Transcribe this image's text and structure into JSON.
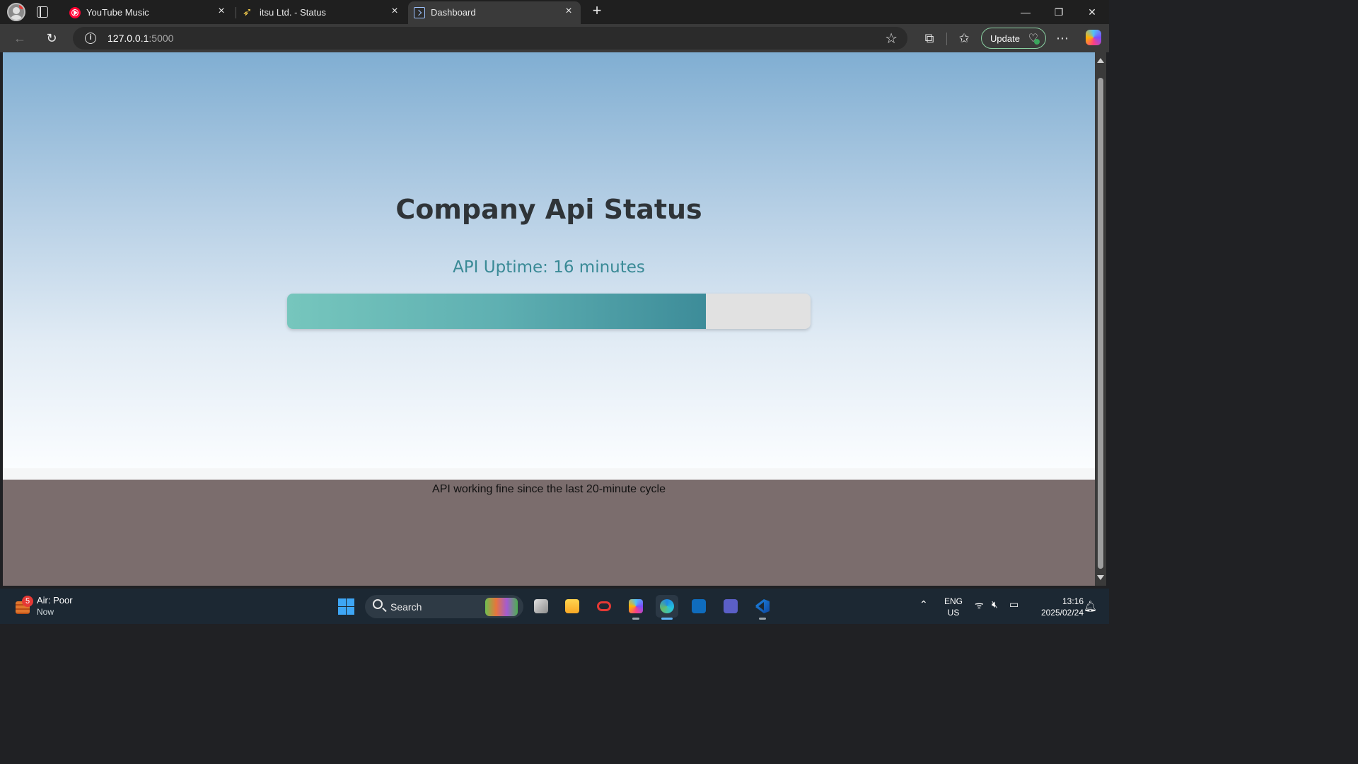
{
  "browser": {
    "tabs": [
      {
        "label": "YouTube Music",
        "favicon": "youtube-music-icon",
        "active": false
      },
      {
        "label": "itsu Ltd. - Status",
        "favicon": "bird-icon",
        "active": false
      },
      {
        "label": "Dashboard",
        "favicon": "dashboard-icon",
        "active": true
      }
    ],
    "address": {
      "host": "127.0.0.1",
      "port": ":5000"
    },
    "update_label": "Update",
    "accent_color": "#8ad0a2"
  },
  "page": {
    "title": "Company Api Status",
    "uptime_text": "API Uptime: 16 minutes",
    "uptime_minutes": 16,
    "cycle_minutes": 20,
    "progress_fraction": 0.8,
    "footer_text": "API working fine since the last 20-minute cycle",
    "colors": {
      "hero_top": "#80aed2",
      "hero_bottom": "#fbfdff",
      "uptime_text": "#3a8a96",
      "bar_fill_start": "#76c6bd",
      "bar_fill_end": "#3d8c99",
      "bar_track": "#e1e1e1",
      "footer_bg": "#7b6d6d"
    }
  },
  "taskbar": {
    "weather": {
      "title": "Air: Poor",
      "subtitle": "Now",
      "badge": "5"
    },
    "search_label": "Search",
    "apps": [
      "task-view-icon",
      "file-explorer-icon",
      "office-icon",
      "copilot-icon",
      "edge-icon",
      "outlook-icon",
      "teams-icon",
      "vscode-icon"
    ],
    "language": {
      "line1": "ENG",
      "line2": "US"
    },
    "clock": {
      "time": "13:16",
      "date": "2025/02/24"
    }
  }
}
